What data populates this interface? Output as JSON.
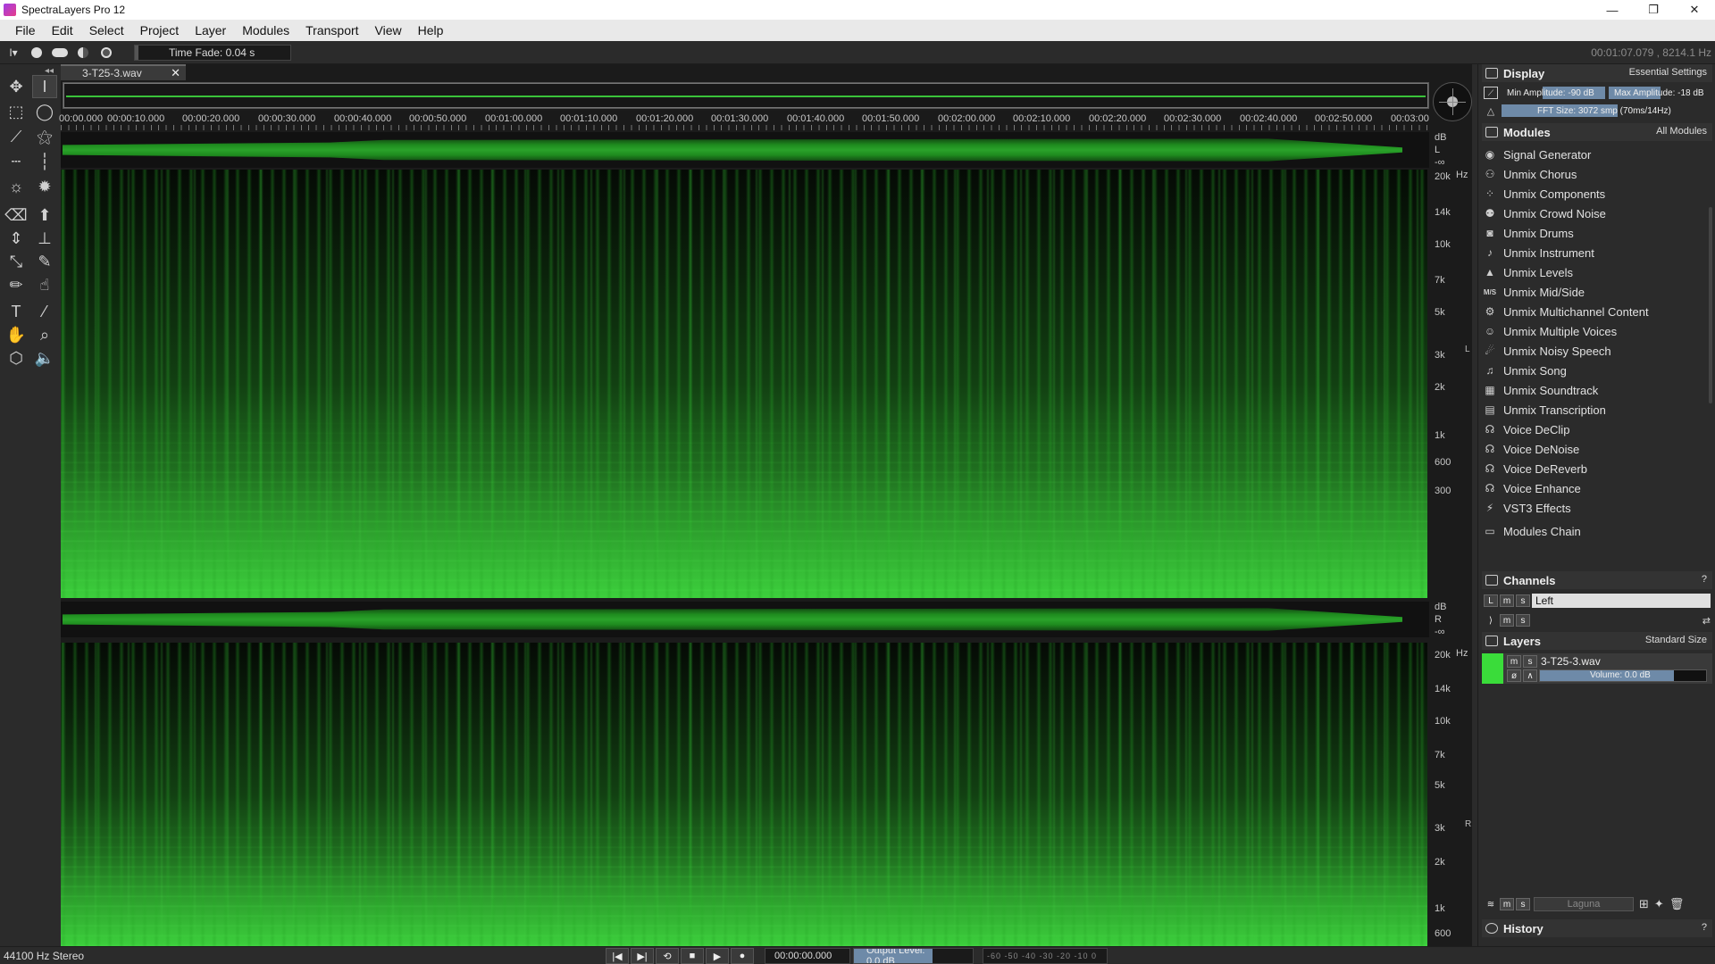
{
  "window": {
    "title": "SpectraLayers Pro 12",
    "controls": [
      "—",
      "❐",
      "✕"
    ]
  },
  "menu": [
    "File",
    "Edit",
    "Select",
    "Project",
    "Layer",
    "Modules",
    "Transport",
    "View",
    "Help"
  ],
  "toolbar": {
    "time_fade": "Time Fade: 0.04 s",
    "cursor_readout": "00:01:07.079 , 8214.1 Hz"
  },
  "editor": {
    "file_tab": "3-T25-3.wav",
    "ruler_ticks": [
      "00:00.000",
      "00:00:10.000",
      "00:00:20.000",
      "00:00:30.000",
      "00:00:40.000",
      "00:00:50.000",
      "00:01:00.000",
      "00:01:10.000",
      "00:01:20.000",
      "00:01:30.000",
      "00:01:40.000",
      "00:01:50.000",
      "00:02:00.000",
      "00:02:10.000",
      "00:02:20.000",
      "00:02:30.000",
      "00:02:40.000",
      "00:02:50.000",
      "00:03:00"
    ],
    "wave_scale": {
      "db": "dB",
      "inf": "-∞",
      "left": "L",
      "right": "R"
    },
    "freq_unit": "Hz",
    "freq_labels": [
      "20k",
      "14k",
      "10k",
      "7k",
      "5k",
      "3k",
      "2k",
      "1k",
      "600",
      "300"
    ],
    "channel_left": "L",
    "channel_right": "R"
  },
  "display": {
    "title": "Display",
    "preset": "Essential Settings",
    "min_amplitude": "Min Amplitude: -90 dB",
    "max_amplitude": "Max Amplitude: -18 dB",
    "fft_size": "FFT Size: 3072 smp (70ms/14Hz)"
  },
  "modules": {
    "title": "Modules",
    "filter": "All Modules",
    "items": [
      {
        "label": "Signal Generator",
        "icon": "wave-icon"
      },
      {
        "label": "Unmix Chorus",
        "icon": "chorus-icon"
      },
      {
        "label": "Unmix Components",
        "icon": "components-icon"
      },
      {
        "label": "Unmix Crowd Noise",
        "icon": "crowd-icon"
      },
      {
        "label": "Unmix Drums",
        "icon": "drum-icon"
      },
      {
        "label": "Unmix Instrument",
        "icon": "instrument-icon"
      },
      {
        "label": "Unmix Levels",
        "icon": "levels-icon"
      },
      {
        "label": "Unmix Mid/Side",
        "icon": "midside-icon"
      },
      {
        "label": "Unmix Multichannel Content",
        "icon": "multichannel-icon"
      },
      {
        "label": "Unmix Multiple Voices",
        "icon": "voices-icon"
      },
      {
        "label": "Unmix Noisy Speech",
        "icon": "speech-icon"
      },
      {
        "label": "Unmix Song",
        "icon": "note-icon"
      },
      {
        "label": "Unmix Soundtrack",
        "icon": "clapper-icon"
      },
      {
        "label": "Unmix Transcription",
        "icon": "transcription-icon"
      },
      {
        "label": "Voice DeClip",
        "icon": "voice-icon"
      },
      {
        "label": "Voice DeNoise",
        "icon": "voice-icon"
      },
      {
        "label": "Voice DeReverb",
        "icon": "voice-icon"
      },
      {
        "label": "Voice Enhance",
        "icon": "voice-icon"
      },
      {
        "label": "VST3 Effects",
        "icon": "plugin-icon"
      }
    ],
    "chain": "Modules Chain"
  },
  "channels": {
    "title": "Channels",
    "row_tag": "L",
    "m": "m",
    "s": "s",
    "name": "Left"
  },
  "layers": {
    "title": "Layers",
    "size": "Standard Size",
    "layer_name": "3-T25-3.wav",
    "m": "m",
    "s": "s",
    "volume": "Volume: 0.0 dB",
    "blend": "Laguna"
  },
  "history": {
    "title": "History"
  },
  "status": {
    "format": "44100 Hz Stereo",
    "timecode": "00:00:00.000",
    "output_level": "Output Level: 0.0 dB",
    "meter_scale": "-60 -50 -40 -30 -20 -10 0"
  },
  "colors": {
    "accent": "#3ac23a",
    "panel": "#2b2b2b",
    "value_bar": "#6e8aa8"
  }
}
